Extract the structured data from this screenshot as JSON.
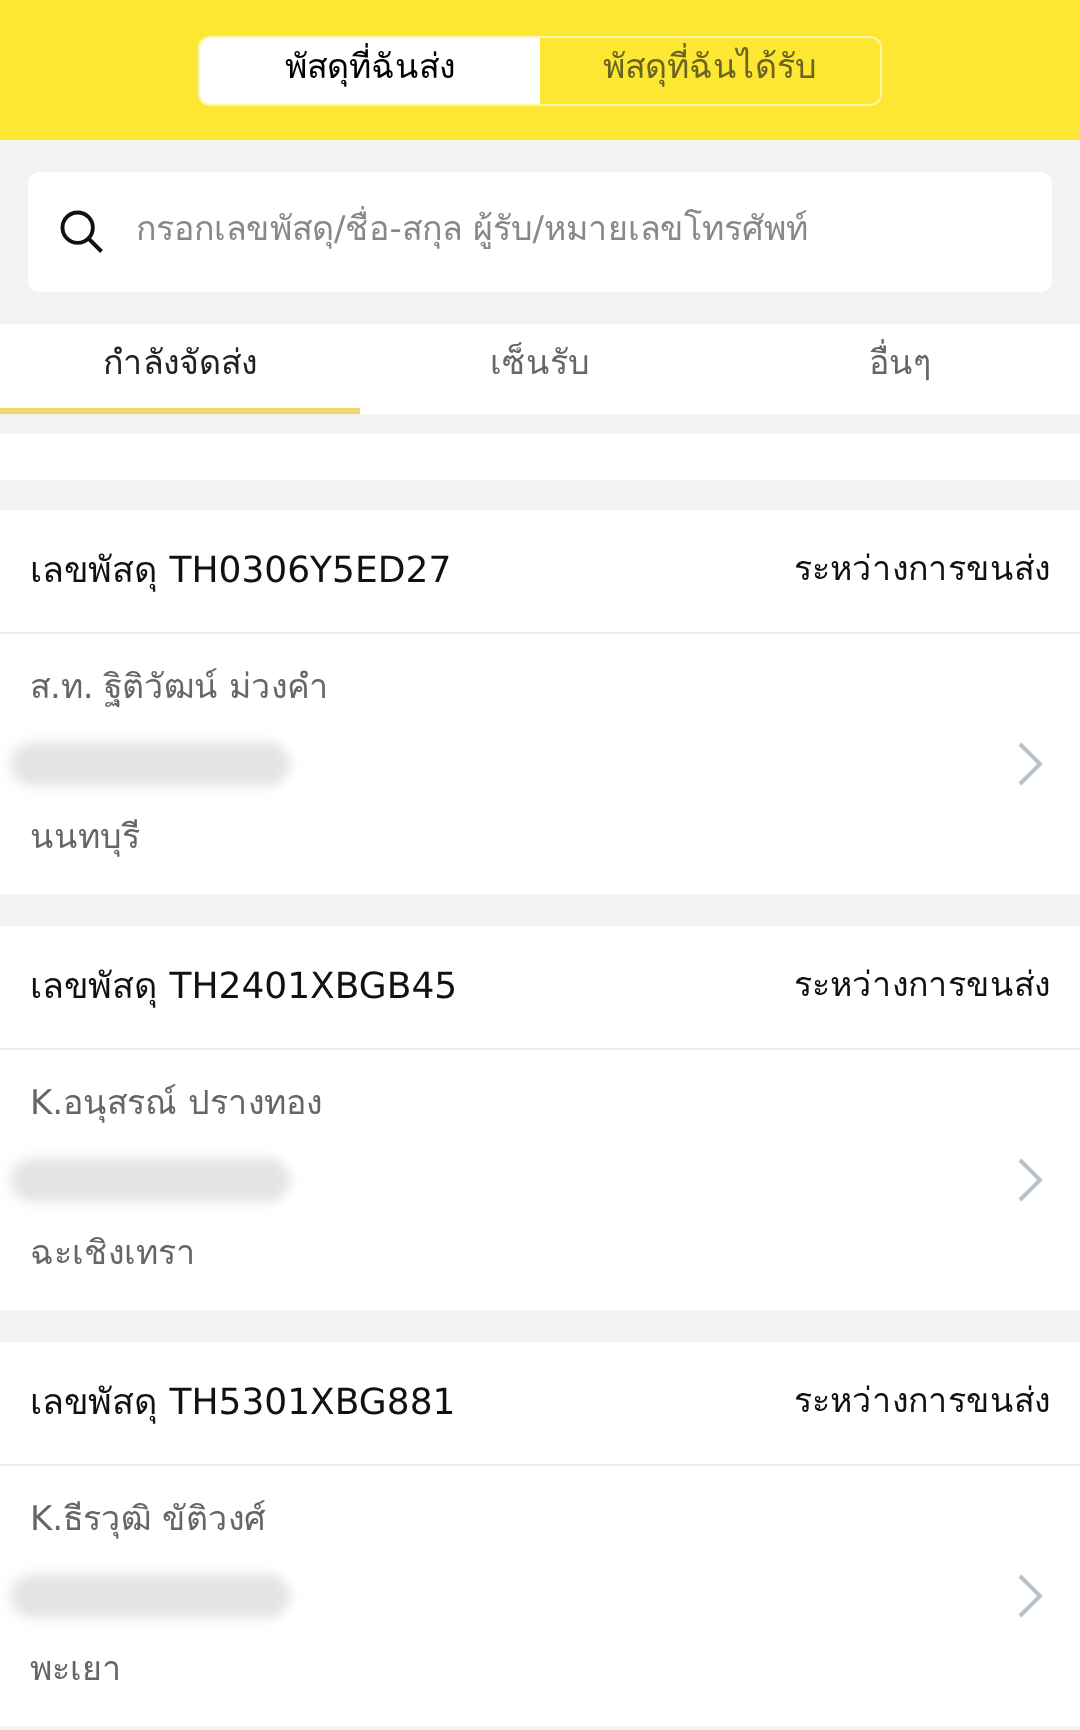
{
  "segments": [
    {
      "label": "พัสดุที่ฉันส่ง",
      "selected": true
    },
    {
      "label": "พัสดุที่ฉันได้รับ",
      "selected": false
    }
  ],
  "search": {
    "placeholder": "กรอกเลขพัสดุ/ชื่อ-สกุล ผู้รับ/หมายเลขโทรศัพท์"
  },
  "tabs": [
    {
      "label": "กำลังจัดส่ง",
      "selected": true
    },
    {
      "label": "เซ็นรับ",
      "selected": false
    },
    {
      "label": "อื่นๆ",
      "selected": false
    }
  ],
  "parcels": [
    {
      "number": "เลขพัสดุ TH0306Y5ED27",
      "status": "ระหว่างการขนส่ง",
      "recipient": "ส.ท. ฐิติวัฒน์ ม่วงคำ",
      "city": "นนทบุรี"
    },
    {
      "number": "เลขพัสดุ TH2401XBGB45",
      "status": "ระหว่างการขนส่ง",
      "recipient": "K.อนุสรณ์ ปรางทอง",
      "city": "ฉะเชิงเทรา"
    },
    {
      "number": "เลขพัสดุ TH5301XBG881",
      "status": "ระหว่างการขนส่ง",
      "recipient": "K.ธีรวุฒิ ขัติวงศ์",
      "city": "พะเยา"
    }
  ]
}
